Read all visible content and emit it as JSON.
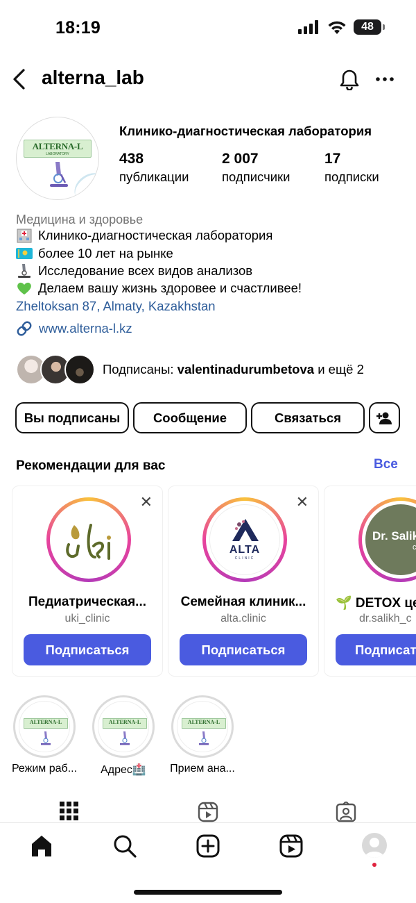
{
  "status_bar": {
    "time": "18:19",
    "battery": "48"
  },
  "header": {
    "username": "alterna_lab"
  },
  "profile": {
    "avatar_text": "ALTERNA-L",
    "avatar_subtext": "LABORATORY",
    "title": "Клинико-диагностическая лаборатория",
    "stats": [
      {
        "value": "438",
        "label": "публикации"
      },
      {
        "value": "2 007",
        "label": "подписчики"
      },
      {
        "value": "17",
        "label": "подписки"
      }
    ],
    "category": "Медицина и здоровье",
    "bio_lines": [
      {
        "icon": "hospital-emoji",
        "text": "Клинико-диагностическая лаборатория"
      },
      {
        "icon": "kazakhstan-flag-emoji",
        "text": "более 10 лет на рынке"
      },
      {
        "icon": "microscope-emoji",
        "text": "Исследование всех видов анализов"
      },
      {
        "icon": "green-heart-emoji",
        "text": "Делаем вашу жизнь здоровее и счастливее!"
      }
    ],
    "address": "Zheltoksan 87, Almaty, Kazakhstan",
    "website": "www.alterna-l.kz",
    "followed_by_prefix": "Подписаны: ",
    "followed_by_user": "valentinadurumbetova",
    "followed_by_suffix": " и ещё 2"
  },
  "actions": {
    "following": "Вы подписаны",
    "message": "Сообщение",
    "contact": "Связаться"
  },
  "recommendations": {
    "title": "Рекомендации для вас",
    "see_all": "Все",
    "cards": [
      {
        "name": "Педиатрическая...",
        "handle": "uki_clinic",
        "button": "Подписаться",
        "logo_text": "uki"
      },
      {
        "name": "Семейная клиник...",
        "handle": "alta.clinic",
        "button": "Подписаться",
        "logo_text": "ALTA",
        "logo_subtext": "CLINIC"
      },
      {
        "name": "🌱 DETOX це",
        "handle": "dr.salikh_c",
        "button": "Подписат",
        "logo_text": "Dr. Salik",
        "logo_subtext": "clir"
      }
    ]
  },
  "highlights": [
    {
      "label": "Режим раб..."
    },
    {
      "label": "Адрес🏥"
    },
    {
      "label": "Прием ана..."
    }
  ],
  "colors": {
    "accent": "#4a5be0",
    "link": "#2e5d9a",
    "secondary_text": "#737373",
    "notification_dot": "#e0243f"
  }
}
